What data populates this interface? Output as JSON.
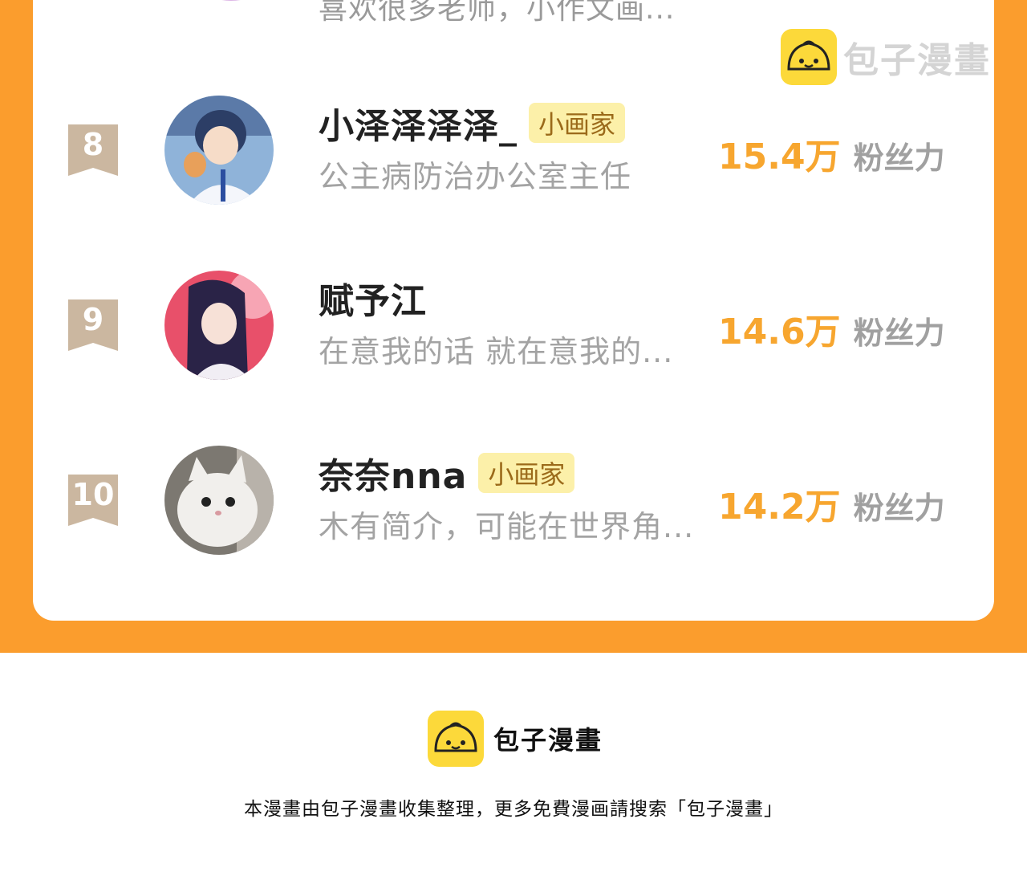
{
  "partial_row": {
    "description": "喜欢很多老师，小作文画..."
  },
  "watermark": {
    "text": "包子漫畫",
    "icon": "bun-logo-icon"
  },
  "ranking": [
    {
      "rank": "8",
      "name": "小泽泽泽泽_",
      "badge": "小画家",
      "description": "公主病防治办公室主任",
      "fans_value": "15.4万",
      "fans_label": "粉丝力"
    },
    {
      "rank": "9",
      "name": "赋予江",
      "badge": "",
      "description": "在意我的话 就在意我的...",
      "fans_value": "14.6万",
      "fans_label": "粉丝力"
    },
    {
      "rank": "10",
      "name": "奈奈nna",
      "badge": "小画家",
      "description": "木有简介，可能在世界角...",
      "fans_value": "14.2万",
      "fans_label": "粉丝力"
    }
  ],
  "footer": {
    "brand": "包子漫畫",
    "note": "本漫畫由包子漫畫收集整理，更多免費漫画請搜索「包子漫畫」"
  },
  "colors": {
    "accent_orange": "#fb9d2d",
    "fans_number": "#f7a62f",
    "badge_bg": "#fcf0a9",
    "logo_yellow": "#fcd93a",
    "rank_flag": "#cbb7a0"
  }
}
